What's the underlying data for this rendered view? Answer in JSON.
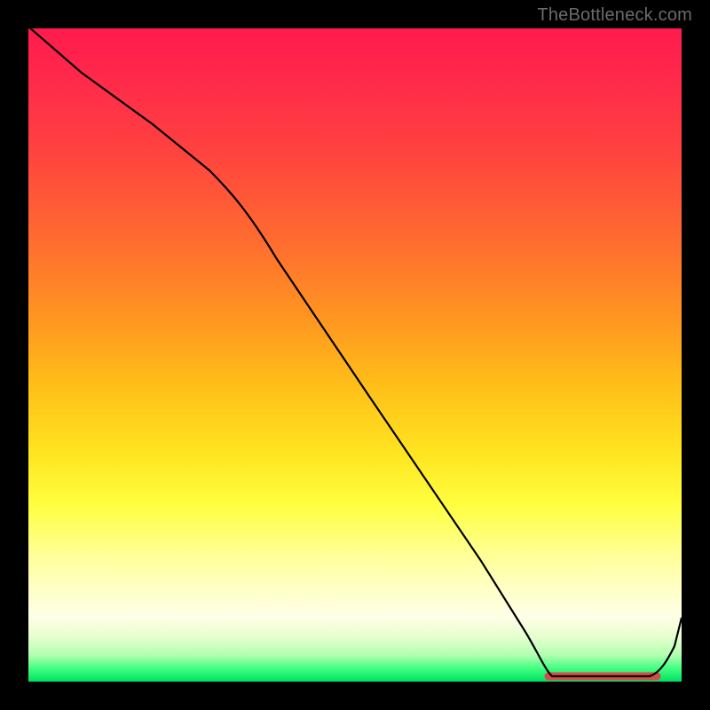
{
  "credit": "TheBottleneck.com",
  "chart_data": {
    "type": "line",
    "title": "",
    "xlabel": "",
    "ylabel": "",
    "xlim": [
      0,
      100
    ],
    "ylim": [
      0,
      100
    ],
    "grid": false,
    "legend": false,
    "series": [
      {
        "name": "curve",
        "x": [
          0,
          10,
          20,
          28,
          40,
          55,
          70,
          80,
          84,
          86,
          90,
          93,
          96,
          100
        ],
        "y": [
          100,
          92,
          84,
          78,
          60,
          38,
          16,
          2,
          0,
          0,
          0,
          0,
          3,
          10
        ],
        "note": "y = 0 is bottom (green); y = 100 is top (red). Minimum plateau around x≈80–96."
      }
    ],
    "min_region_x": [
      80,
      96
    ],
    "gradient_stops": [
      {
        "pos": 0.0,
        "color": "#ff1a4d"
      },
      {
        "pos": 0.5,
        "color": "#ffb020"
      },
      {
        "pos": 0.75,
        "color": "#ffff40"
      },
      {
        "pos": 1.0,
        "color": "#00e060"
      }
    ]
  }
}
